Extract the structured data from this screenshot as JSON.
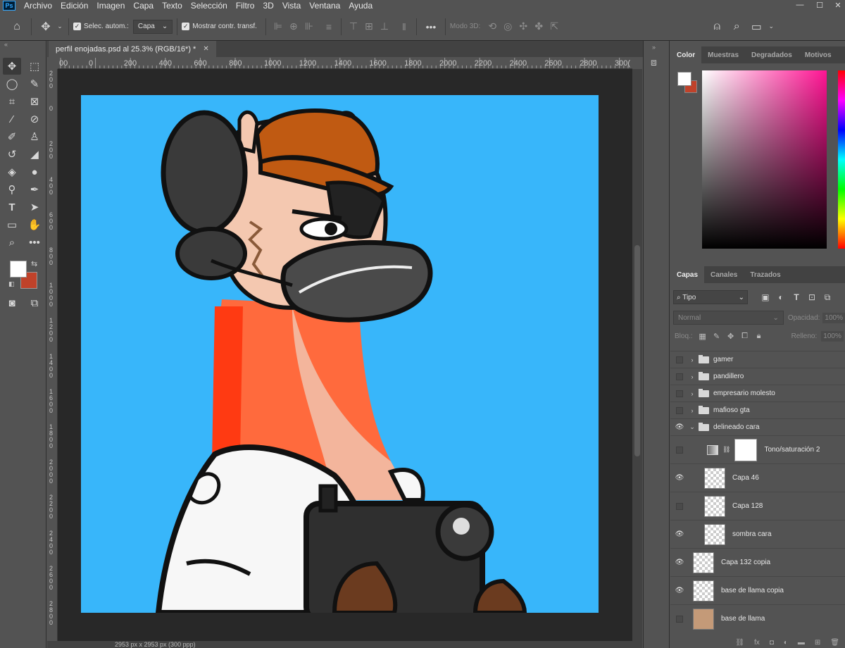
{
  "app": {
    "logo": "Ps"
  },
  "menu": [
    "Archivo",
    "Edición",
    "Imagen",
    "Capa",
    "Texto",
    "Selección",
    "Filtro",
    "3D",
    "Vista",
    "Ventana",
    "Ayuda"
  ],
  "options": {
    "auto_select_label": "Selec. autom.:",
    "auto_select_value": "Capa",
    "show_transform_label": "Mostrar contr. transf.",
    "mode3d_label": "Modo 3D:"
  },
  "document": {
    "tab_title": "perfil enojadas.psd al 25.3% (RGB/16*) *",
    "status_text": "2953 px x 2953 px (300 ppp)"
  },
  "ruler": {
    "top_labels": [
      "00",
      "0",
      "200",
      "400",
      "600",
      "800",
      "1000",
      "1200",
      "1400",
      "1600",
      "1800",
      "2000",
      "2200",
      "2400",
      "2600",
      "2800",
      "300("
    ],
    "left_labels": [
      "2\n0\n0",
      "0",
      "2\n0\n0",
      "4\n0\n0",
      "6\n0\n0",
      "8\n0\n0",
      "1\n0\n0\n0",
      "1\n2\n0\n0",
      "1\n4\n0\n0",
      "1\n6\n0\n0",
      "1\n8\n0\n0",
      "2\n0\n0\n0",
      "2\n2\n0\n0",
      "2\n4\n0\n0",
      "2\n6\n0\n0",
      "2\n8\n0\n0"
    ]
  },
  "colors": {
    "foreground": "#ffffff",
    "background": "#c0422a",
    "canvas_bg": "#38b6fa",
    "picker_hue": "#ff1493"
  },
  "color_panel": {
    "tabs": [
      "Color",
      "Muestras",
      "Degradados",
      "Motivos"
    ]
  },
  "layers_panel": {
    "tabs": [
      "Capas",
      "Canales",
      "Trazados"
    ],
    "kind_filter": "Tipo",
    "blend_mode": "Normal",
    "opacity_label": "Opacidad:",
    "opacity_value": "100%",
    "lock_label": "Bloq.:",
    "fill_label": "Relleno:",
    "fill_value": "100%",
    "layers": [
      {
        "name": "gamer",
        "type": "group",
        "visible": false
      },
      {
        "name": "pandillero",
        "type": "group",
        "visible": false
      },
      {
        "name": "empresario molesto",
        "type": "group",
        "visible": false
      },
      {
        "name": "mafioso gta",
        "type": "group",
        "visible": false
      },
      {
        "name": "delineado cara",
        "type": "group-open",
        "visible": true
      },
      {
        "name": "Tono/saturación 2",
        "type": "adjustment",
        "visible": false
      },
      {
        "name": "Capa 46",
        "type": "pixel",
        "visible": true
      },
      {
        "name": "Capa 128",
        "type": "pixel",
        "visible": false
      },
      {
        "name": "sombra cara",
        "type": "pixel",
        "visible": true
      },
      {
        "name": "Capa 132 copia",
        "type": "pixel",
        "visible": true
      },
      {
        "name": "base de llama copia",
        "type": "pixel",
        "visible": true
      },
      {
        "name": "base de llama",
        "type": "pixel",
        "visible": false
      }
    ]
  }
}
